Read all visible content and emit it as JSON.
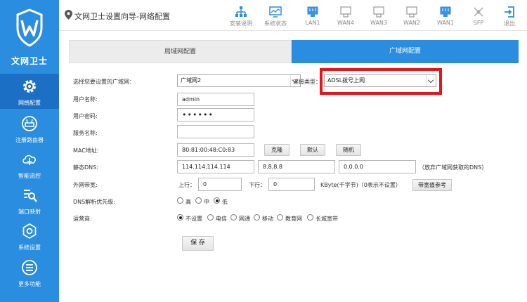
{
  "app": {
    "logo_text": "文网卫士",
    "accent": "#2a8de0",
    "active_nav": "#1b6fc4",
    "highlight": "#e8141c"
  },
  "sidebar": {
    "items": [
      {
        "label": "网络配置",
        "icon": "gear-icon"
      },
      {
        "label": "注册路由器",
        "icon": "router-icon"
      },
      {
        "label": "智能流控",
        "icon": "flow-control-icon"
      },
      {
        "label": "端口映射",
        "icon": "port-mapping-icon"
      },
      {
        "label": "系统设置",
        "icon": "settings-icon"
      },
      {
        "label": "更多功能",
        "icon": "more-menu-icon"
      }
    ]
  },
  "header": {
    "breadcrumb": "文网卫士设置向导-网络配置",
    "toolbar": [
      {
        "label": "安装说明",
        "icon": "network-topology-icon"
      },
      {
        "label": "系统状态",
        "icon": "monitor-icon"
      },
      {
        "label": "LAN1",
        "icon": "lan-port-icon"
      },
      {
        "label": "WAN4",
        "icon": "wan-port-icon"
      },
      {
        "label": "WAN3",
        "icon": "wan-port-icon"
      },
      {
        "label": "WAN2",
        "icon": "wan-port-icon"
      },
      {
        "label": "WAN1",
        "icon": "wan-port-icon"
      },
      {
        "label": "SFP",
        "icon": "sfp-icon"
      },
      {
        "label": "退出",
        "icon": "logout-icon"
      }
    ]
  },
  "tabs": {
    "lan": "局域网配置",
    "wan": "广域网配置"
  },
  "form": {
    "wan_select_label": "选择您要设置的广域网：",
    "wan_select_value": "广域网2",
    "conn_type_label": "连接类型：",
    "conn_type_value": "ADSL拨号上网",
    "username_label": "用户名称:",
    "username_value": "admin",
    "password_label": "用户密码:",
    "password_value": "••••••",
    "service_label": "服务名称:",
    "service_value": "",
    "mac_label": "MAC地址:",
    "mac_value": "80:81:00:48:C0:83",
    "clone_btn": "克隆",
    "default_btn": "默认",
    "random_btn": "随机",
    "dns_label": "静态DNS:",
    "dns1": "114.114.114.114",
    "dns2": "8.8.8.8",
    "dns3": "0.0.0.0",
    "dns_note": "（放弃广域网获取的DNS）",
    "bandwidth_label": "外网带宽:",
    "up_label": "上行：",
    "up_value": "0",
    "down_label": "下行：",
    "down_value": "0",
    "bw_note": "KByte(千字节)（0表示不设置）",
    "bw_ref_btn": "带宽值参考",
    "dns_priority_label": "DNS解析优先级:",
    "priority_options": [
      "高",
      "中",
      "低"
    ],
    "priority_selected": "低",
    "isp_label": "运营商:",
    "isp_options": [
      "不设置",
      "电信",
      "网通",
      "移动",
      "教育网",
      "长城宽带"
    ],
    "isp_selected": "不设置",
    "save_btn": "保 存"
  }
}
